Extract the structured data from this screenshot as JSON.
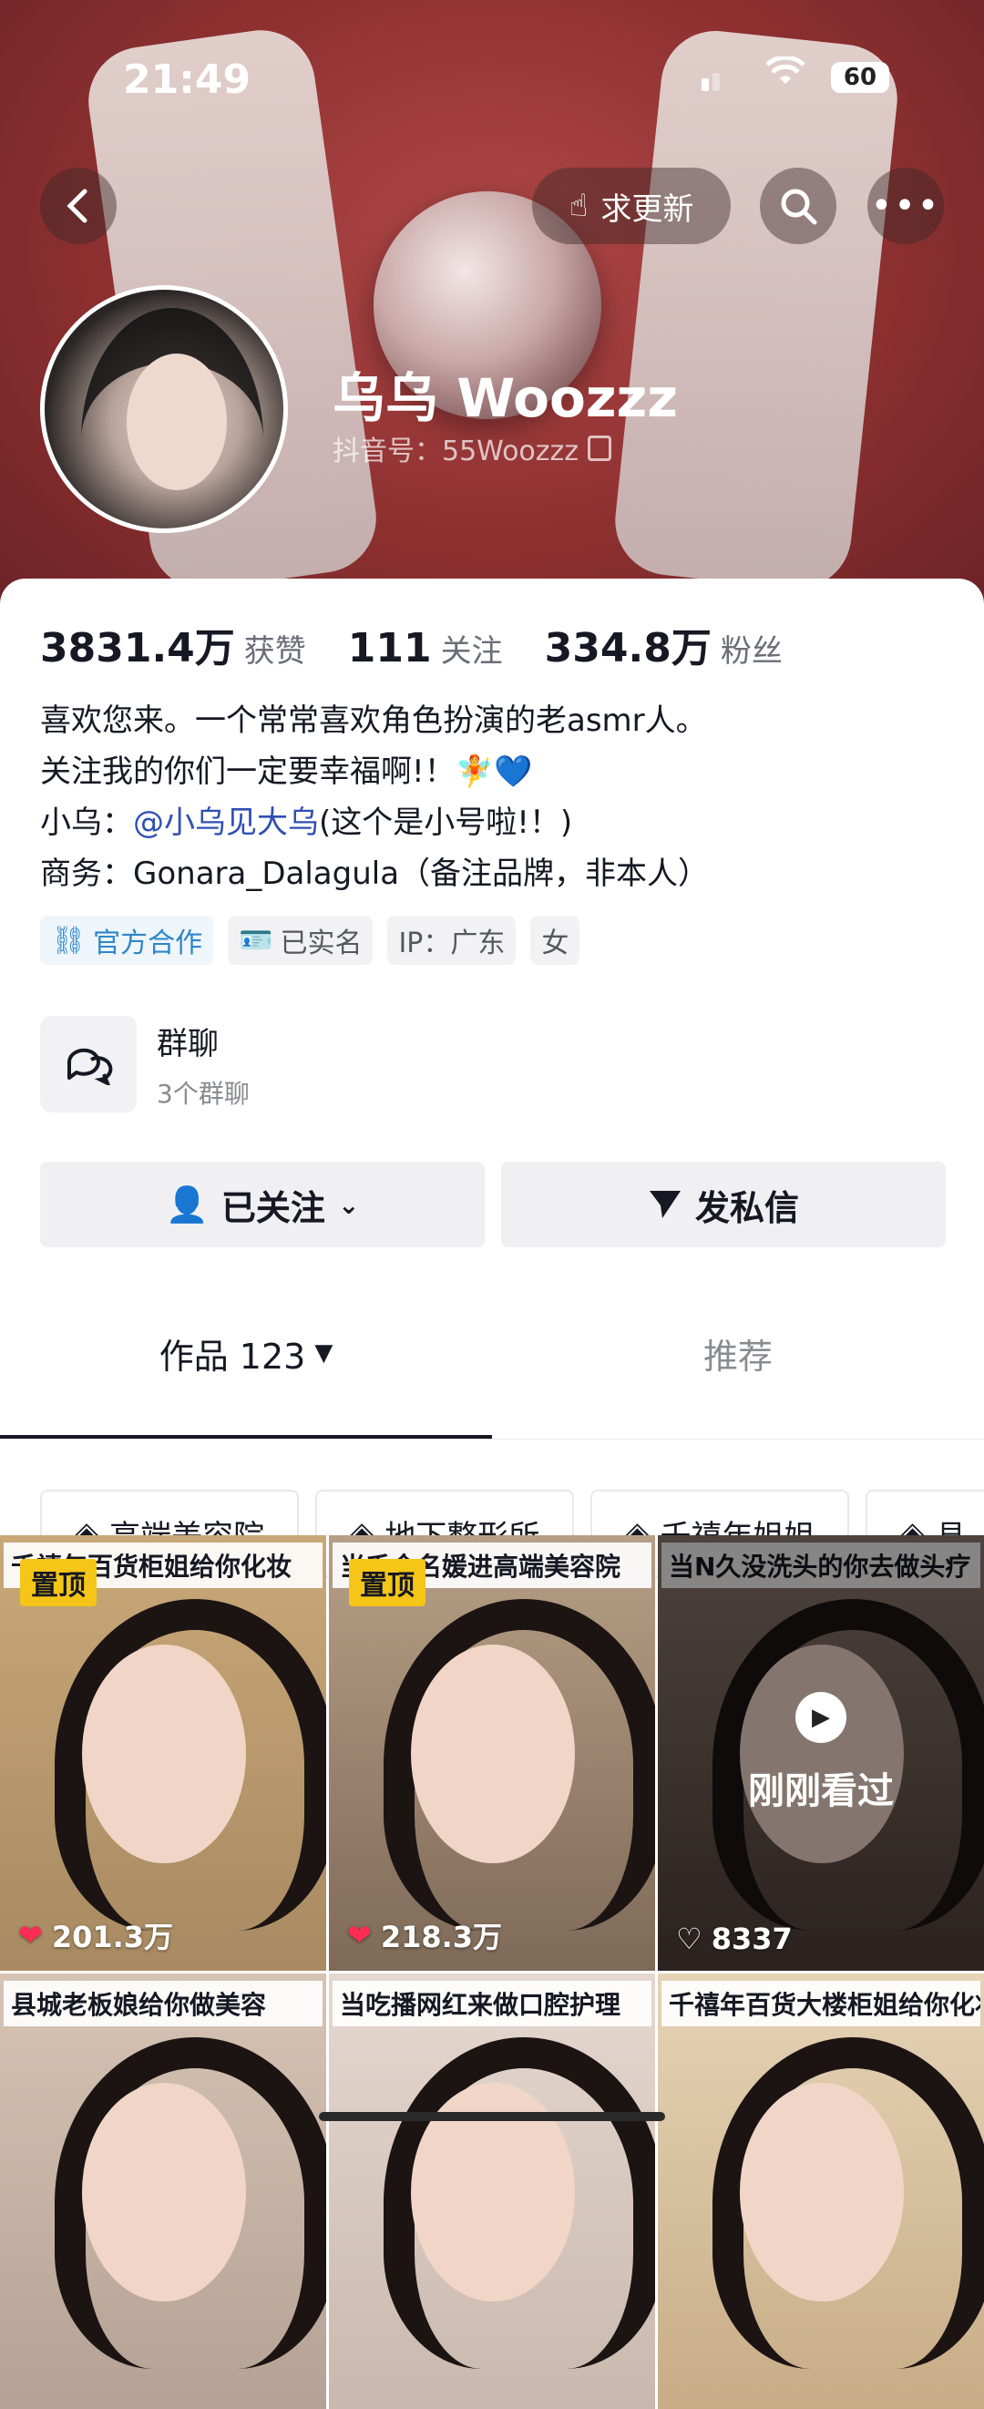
{
  "status_bar": {
    "time": "21:49",
    "battery": "60"
  },
  "header": {
    "update_request_label": "求更新",
    "name": "乌乌 Woozzz",
    "douyin_id": "抖音号：55Woozzz"
  },
  "stats": [
    {
      "value": "3831.4万",
      "label": "获赞"
    },
    {
      "value": "111",
      "label": "关注"
    },
    {
      "value": "334.8万",
      "label": "粉丝"
    }
  ],
  "bio": {
    "line1": "喜欢您来。一个常常喜欢角色扮演的老asmr人。",
    "line2": "关注我的你们一定要幸福啊!！🧚💙",
    "line3_prefix": "小乌：",
    "line3_link": "@小乌见大乌",
    "line3_suffix": "(这个是小号啦!！)",
    "line4": "商务：Gonara_Dalagula（备注品牌，非本人）"
  },
  "tags": [
    "官方合作",
    "已实名",
    "IP：广东",
    "女"
  ],
  "group": {
    "title": "群聊",
    "subtitle": "3个群聊"
  },
  "buttons": {
    "followed": "已关注",
    "message": "发私信"
  },
  "tabs": {
    "works": "作品 123",
    "recommend": "推荐"
  },
  "chips": [
    "高端美容院",
    "地下整形所",
    "千禧年姐姐",
    "县"
  ],
  "videos": [
    {
      "title": "千禧年百货柜姐给你化妆",
      "pinned": "置顶",
      "likes": "201.3万"
    },
    {
      "title": "当千金名媛进高端美容院",
      "pinned": "置顶",
      "likes": "218.3万"
    },
    {
      "title": "当N久没洗头的你去做头疗",
      "watched": "刚刚看过",
      "likes": "8337"
    },
    {
      "title": "县城老板娘给你做美容"
    },
    {
      "title": "当吃播网红来做口腔护理"
    },
    {
      "title": "千禧年百货大楼柜姐给你化妆"
    }
  ]
}
